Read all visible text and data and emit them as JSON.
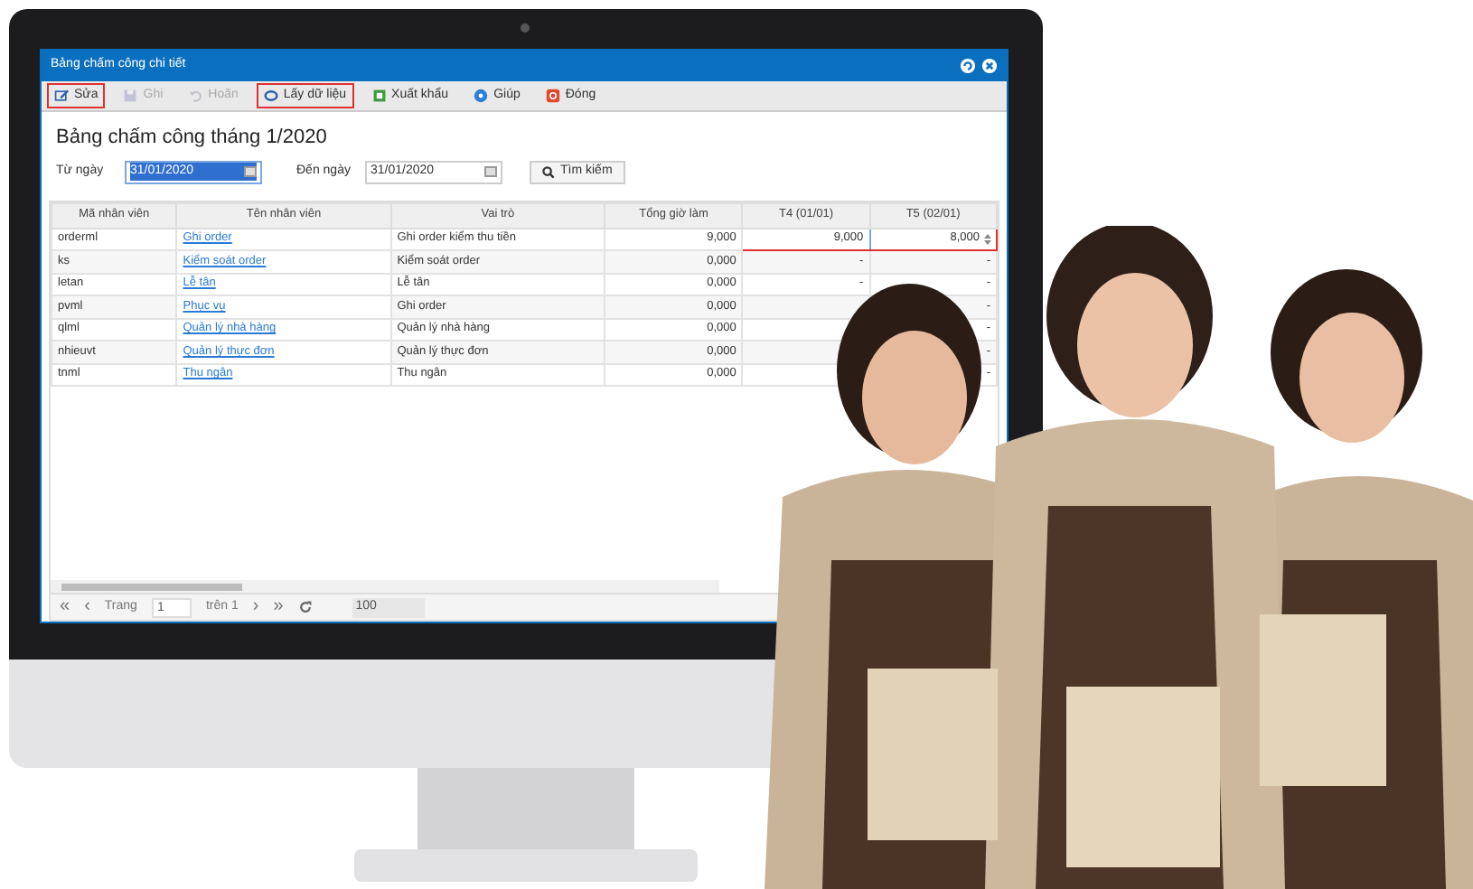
{
  "window": {
    "title": "Bảng chấm công chi tiết"
  },
  "toolbar": [
    {
      "label": "Sửa",
      "kind": "edit",
      "disabled": false,
      "highlighted": true
    },
    {
      "label": "Ghi",
      "kind": "save",
      "disabled": true,
      "highlighted": false
    },
    {
      "label": "Hoãn",
      "kind": "undo",
      "disabled": true,
      "highlighted": false
    },
    {
      "label": "Lấy dữ liệu",
      "kind": "refresh",
      "disabled": false,
      "highlighted": true
    },
    {
      "label": "Xuất khẩu",
      "kind": "export",
      "disabled": false,
      "highlighted": false
    },
    {
      "label": "Giúp",
      "kind": "help",
      "disabled": false,
      "highlighted": false
    },
    {
      "label": "Đóng",
      "kind": "close",
      "disabled": false,
      "highlighted": false
    }
  ],
  "heading": "Bảng chấm công tháng 1/2020",
  "filters": {
    "from_label": "Từ ngày",
    "from_value": "31/01/2020",
    "to_label": "Đến ngày",
    "to_value": "31/01/2020",
    "search_button": "Tìm kiếm"
  },
  "table": {
    "columns": [
      "Mã nhân viên",
      "Tên nhân viên",
      "Vai trò",
      "Tổng giờ làm",
      "T4 (01/01)",
      "T5 (02/01)"
    ],
    "rows": [
      {
        "code": "orderml",
        "name": "Ghi order",
        "role": "Ghi order kiểm thu tiền",
        "total": "9,000",
        "t4": "9,000",
        "t5": "8,000",
        "editing": true
      },
      {
        "code": "ks",
        "name": "Kiểm soát order",
        "role": "Kiểm soát order",
        "total": "0,000",
        "t4": "-",
        "t5": "-",
        "editing": false
      },
      {
        "code": "letan",
        "name": "Lễ tân",
        "role": "Lễ tân",
        "total": "0,000",
        "t4": "-",
        "t5": "-",
        "editing": false
      },
      {
        "code": "pvml",
        "name": "Phục vụ",
        "role": "Ghi order",
        "total": "0,000",
        "t5": "-",
        "editing": false
      },
      {
        "code": "qlml",
        "name": "Quản lý nhà hàng",
        "role": "Quản lý nhà hàng",
        "total": "0,000",
        "t5": "-",
        "editing": false
      },
      {
        "code": "nhieuvt",
        "name": "Quản lý thực đơn",
        "role": "Quản lý thực đơn",
        "total": "0,000",
        "t5": "-",
        "editing": false
      },
      {
        "code": "tnml",
        "name": "Thu ngân",
        "role": "Thu ngân",
        "total": "0,000",
        "t5": "-",
        "editing": false
      }
    ]
  },
  "pager": {
    "first": "«",
    "prev": "‹",
    "page_label": "Trang",
    "page": "1",
    "of": "trên 1",
    "next": "›",
    "last": "»",
    "page_size": "100"
  }
}
